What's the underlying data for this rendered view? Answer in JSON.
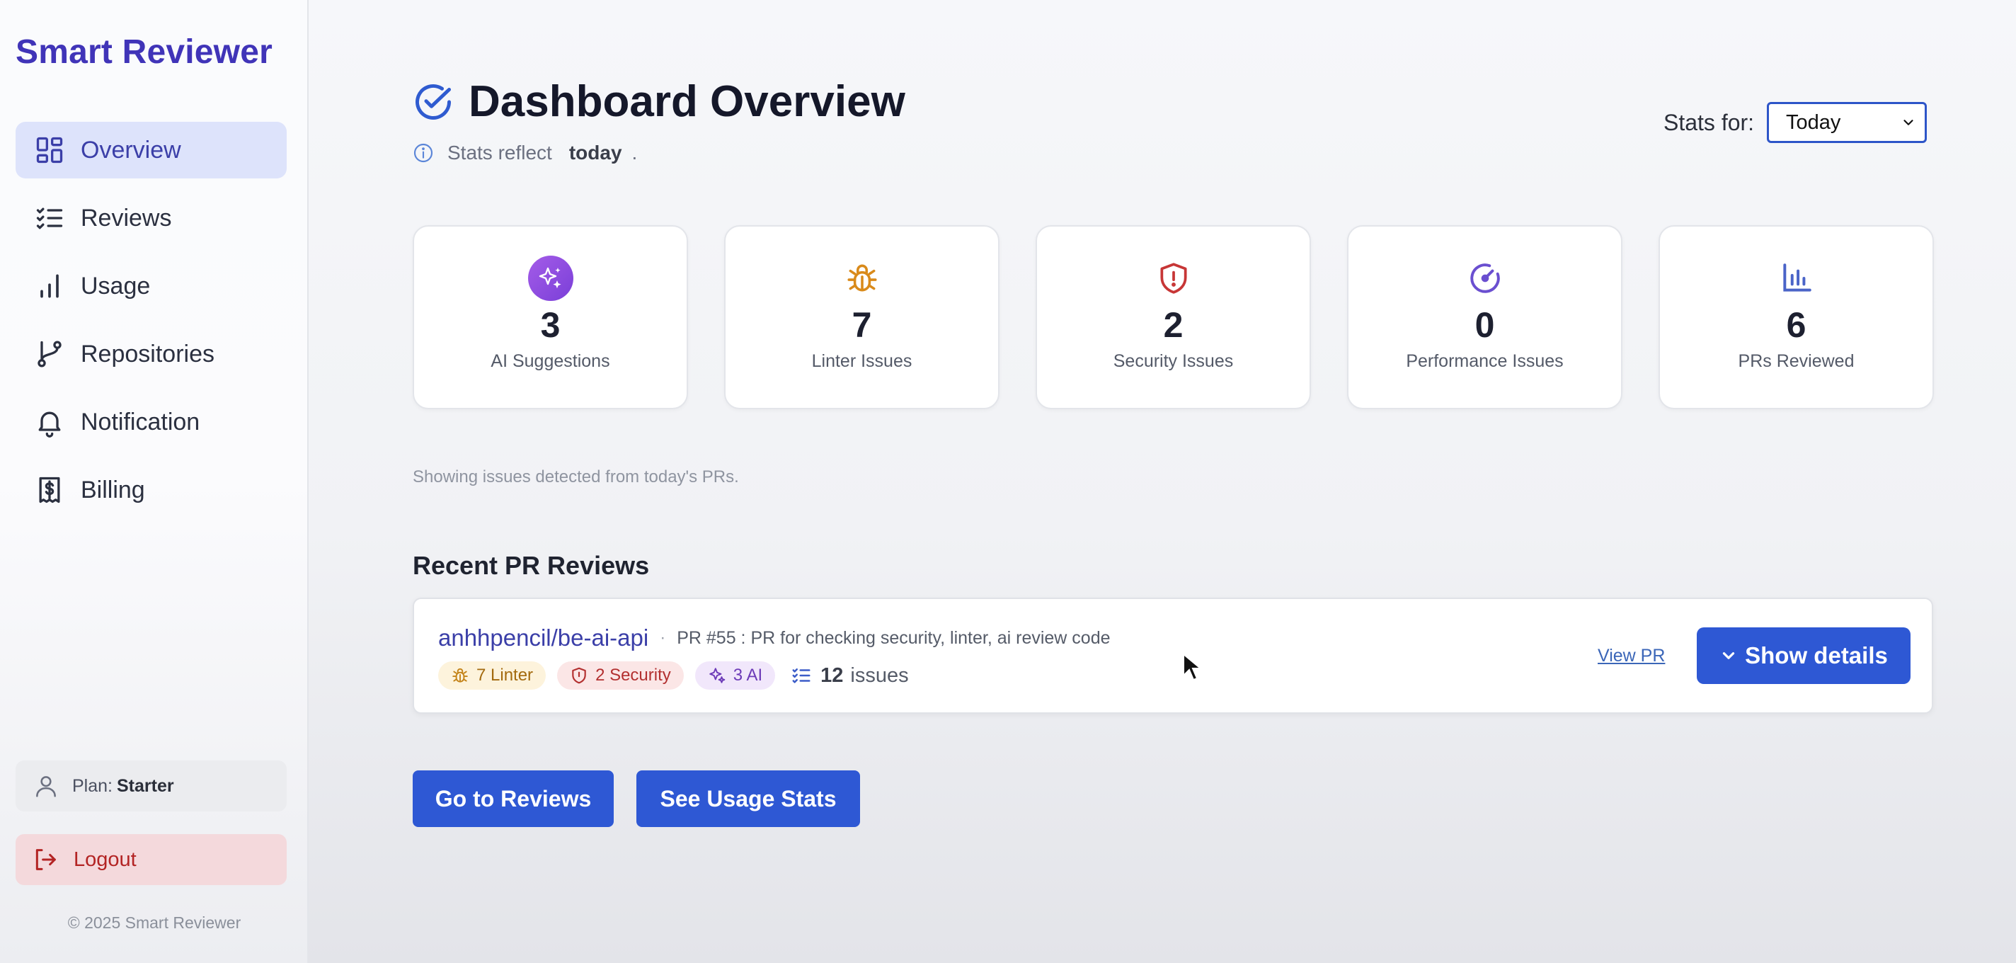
{
  "brand": "Smart Reviewer",
  "colors": {
    "accent": "#2e58d4",
    "brand": "#4034b8",
    "active_nav_bg": "#dde3fb",
    "danger": "#b32424"
  },
  "sidebar": {
    "items": [
      {
        "label": "Overview",
        "icon": "grid-icon",
        "active": true
      },
      {
        "label": "Reviews",
        "icon": "checklist-icon",
        "active": false
      },
      {
        "label": "Usage",
        "icon": "bar-chart-icon",
        "active": false
      },
      {
        "label": "Repositories",
        "icon": "git-branch-icon",
        "active": false
      },
      {
        "label": "Notification",
        "icon": "bell-icon",
        "active": false
      },
      {
        "label": "Billing",
        "icon": "receipt-dollar-icon",
        "active": false
      }
    ],
    "plan_label": "Plan:",
    "plan_value": "Starter",
    "logout_label": "Logout",
    "copyright": "© 2025 Smart Reviewer"
  },
  "header": {
    "title": "Dashboard Overview",
    "subtitle_prefix": "Stats reflect",
    "subtitle_period": "today",
    "subtitle_suffix": ".",
    "stats_for_label": "Stats for:",
    "stats_for_value": "Today"
  },
  "stats": [
    {
      "value": "3",
      "label": "AI Suggestions",
      "icon": "sparkles-icon",
      "color": "#8b4fe0"
    },
    {
      "value": "7",
      "label": "Linter Issues",
      "icon": "bug-icon",
      "color": "#d98a1a"
    },
    {
      "value": "2",
      "label": "Security Issues",
      "icon": "shield-alert-icon",
      "color": "#c73636"
    },
    {
      "value": "0",
      "label": "Performance Issues",
      "icon": "gauge-icon",
      "color": "#6a4fd0"
    },
    {
      "value": "6",
      "label": "PRs Reviewed",
      "icon": "bar-chart-icon",
      "color": "#4a64c8"
    }
  ],
  "hint": "Showing issues detected from today's PRs.",
  "recent": {
    "title": "Recent PR Reviews",
    "items": [
      {
        "repo": "anhhpencil/be-ai-api",
        "separator": "·",
        "description": "PR #55 : PR for checking security, linter, ai review code",
        "linter": "7 Linter",
        "security": "2 Security",
        "ai": "3 AI",
        "issues_count": "12",
        "issues_label": "issues",
        "view_label": "View PR",
        "details_label": "Show details"
      }
    ]
  },
  "actions": {
    "go_reviews": "Go to Reviews",
    "usage_stats": "See Usage Stats"
  }
}
